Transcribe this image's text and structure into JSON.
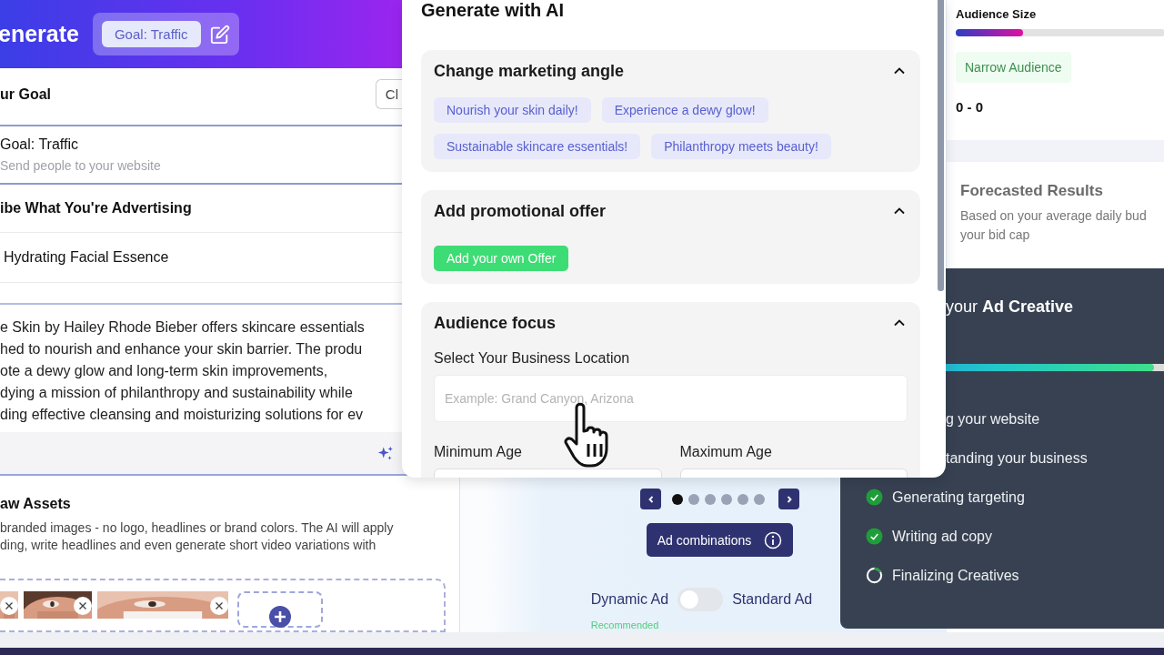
{
  "header": {
    "title": "enerate",
    "goal_chip": "Goal: Traffic"
  },
  "goal_section": {
    "title": "ur Goal",
    "button": "Cl",
    "goal_title": "Goal: Traffic",
    "goal_subtitle": "Send people to your website"
  },
  "describe_section": {
    "title": "ibe What You're Advertising",
    "product": "Hydrating Facial Essence",
    "description_lines": [
      "e Skin by Hailey Rhode Bieber offers skincare essentials",
      "hed to nourish and enhance your skin barrier. The produ",
      "ote a dewy glow and long-term skin improvements,",
      "dying a mission of philanthropy and sustainability while",
      "ding effective cleansing and moisturizing solutions for ev"
    ]
  },
  "assets_section": {
    "title": "aw Assets",
    "description_lines": [
      "branded images - no logo, headlines or brand colors. The AI will apply",
      "ding, write headlines and even generate short video variations with"
    ],
    "thumbnails": [
      {
        "kind": "picture"
      },
      {
        "kind": "picture"
      },
      {
        "kind": "picture"
      }
    ]
  },
  "preview": {
    "pages": [
      {
        "selected": true
      },
      {
        "selected": false
      },
      {
        "selected": false
      },
      {
        "selected": false
      },
      {
        "selected": false
      },
      {
        "selected": false
      }
    ],
    "combinations_button": "Ad combinations",
    "toggle_left": "Dynamic Ad",
    "toggle_right": "Standard Ad",
    "toggle_on": false,
    "note": "Recommended"
  },
  "audience": {
    "title": "Audience Size",
    "level": 0.32,
    "badge": "Narrow Audience",
    "range": "0 - 0"
  },
  "forecast": {
    "title": "Forecasted Results",
    "description_lines": [
      "Based on your average daily bud",
      "your bid cap"
    ]
  },
  "ai_panel": {
    "title": "Generate with AI",
    "sections": [
      {
        "kind": "angles",
        "title": "Change marketing angle",
        "expanded": true,
        "chips": [
          "Nourish your skin daily!",
          "Experience a dewy glow!",
          "Sustainable skincare essentials!",
          "Philanthropy meets beauty!"
        ]
      },
      {
        "kind": "offer",
        "title": "Add promotional offer",
        "expanded": true,
        "button": "Add your own Offer"
      },
      {
        "kind": "audience",
        "title": "Audience focus",
        "expanded": true,
        "location_label": "Select Your Business Location",
        "location_placeholder": "Example: Grand Canyon, Arizona",
        "min_age_label": "Minimum Age",
        "max_age_label": "Maximum Age"
      }
    ]
  },
  "progress_panel": {
    "title": "your **Ad Creative**",
    "level": 0.97,
    "steps": [
      {
        "label": "g your website"
      },
      {
        "label": "tanding your business"
      },
      {
        "label": "Generating targeting",
        "complete": true
      },
      {
        "label": "Writing ad copy",
        "complete": true
      },
      {
        "label": "Finalizing Creatives",
        "complete": false
      }
    ]
  }
}
